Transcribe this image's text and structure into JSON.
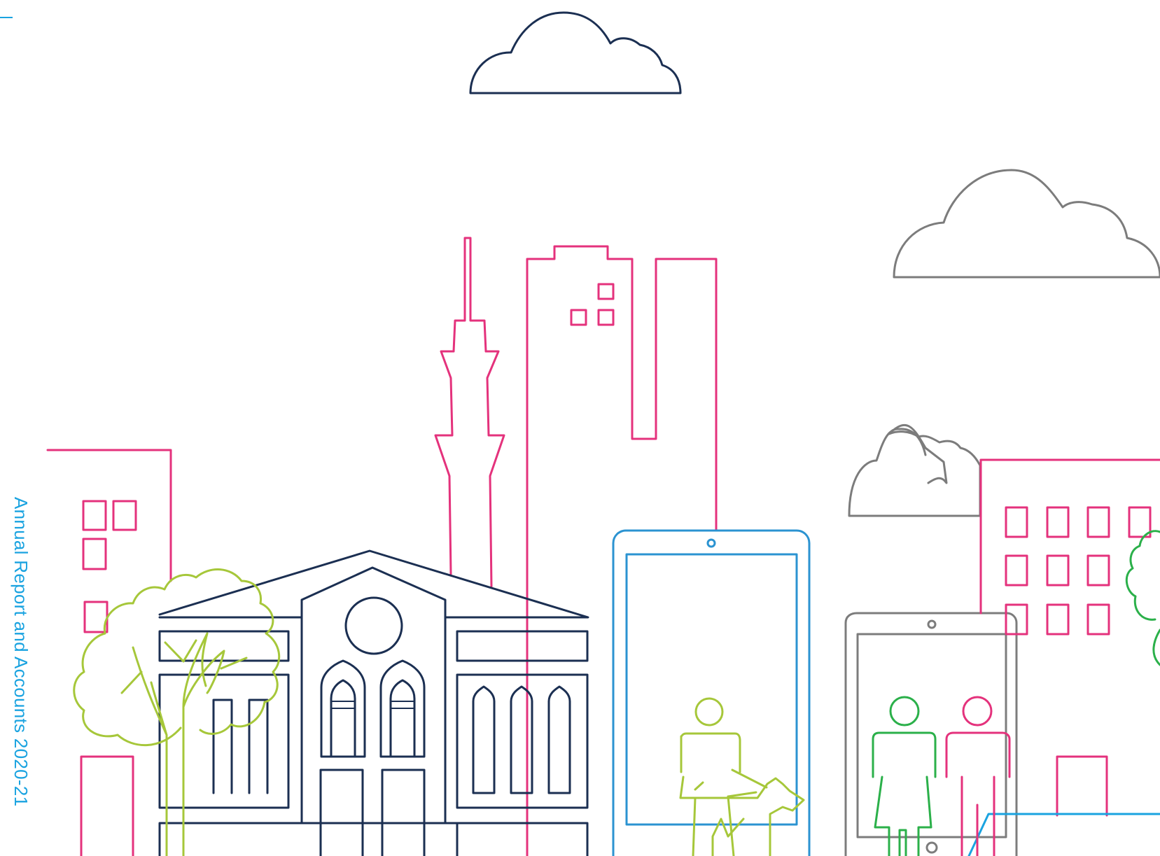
{
  "report": {
    "title": "Annual Report and Accounts 2020-21"
  },
  "colors": {
    "navy": "#1b2f52",
    "magenta": "#e4327c",
    "lime": "#a6c73a",
    "green": "#2bb04a",
    "sky": "#2b93d1",
    "cyan": "#1aa3e0",
    "grey": "#7c7c7c",
    "text": "#1aa3e0"
  },
  "illustration": {
    "elements": [
      "cloud-top",
      "cloud-right",
      "cloud-small",
      "tv-tower",
      "tall-building",
      "building-left",
      "museum",
      "tree-left",
      "tablet",
      "tablet-small",
      "building-right",
      "person-with-dog",
      "person-green",
      "person-pink",
      "tree-right"
    ]
  }
}
